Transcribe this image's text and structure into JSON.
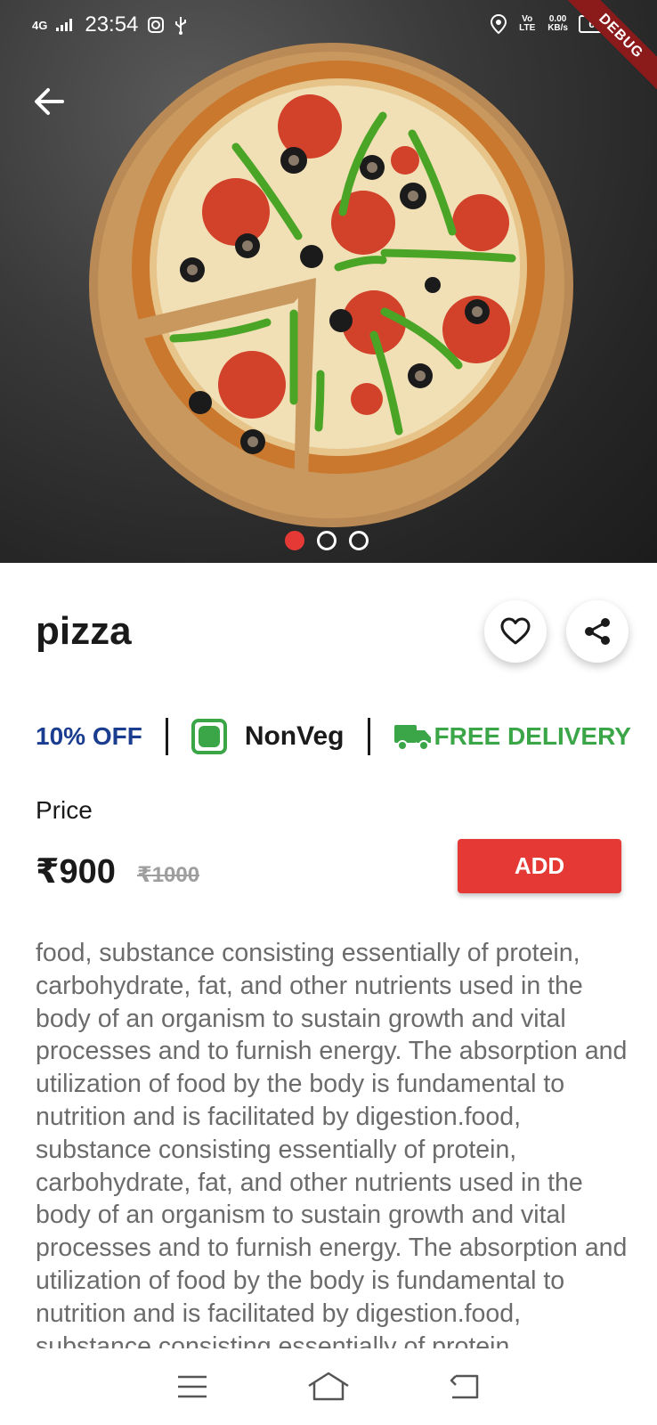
{
  "status_bar": {
    "network": "4G",
    "time": "23:54",
    "volte": "Vo LTE",
    "speed": "0.00",
    "speed_unit": "KB/s",
    "battery": "68",
    "debug_banner": "DEBUG"
  },
  "carousel": {
    "slide_count": 3,
    "active_index": 0
  },
  "product": {
    "title": "pizza",
    "discount": "10% OFF",
    "type": "NonVeg",
    "delivery": "FREE DELIVERY",
    "price_label": "Price",
    "price": "₹900",
    "old_price": "₹1000",
    "add_label": "ADD",
    "description": "food, substance consisting essentially of protein, carbohydrate, fat, and other nutrients used in the body of an organism to sustain growth and vital processes and to furnish energy. The absorption and utilization of food by the body is fundamental to nutrition and is facilitated by digestion.food, substance consisting essentially of protein, carbohydrate, fat, and other nutrients used in the body of an organism to sustain growth and vital processes and to furnish energy. The absorption and utilization of food by the body is fundamental to nutrition and is facilitated by digestion.food, substance consisting essentially of protein,"
  },
  "colors": {
    "accent": "#e53935",
    "discount": "#1a3d8f",
    "green": "#3aa647"
  },
  "icons": {
    "back": "arrow-left-icon",
    "favorite": "heart-icon",
    "share": "share-icon",
    "delivery": "truck-icon",
    "nav_menu": "menu-icon",
    "nav_home": "home-icon",
    "nav_back": "back-icon"
  }
}
